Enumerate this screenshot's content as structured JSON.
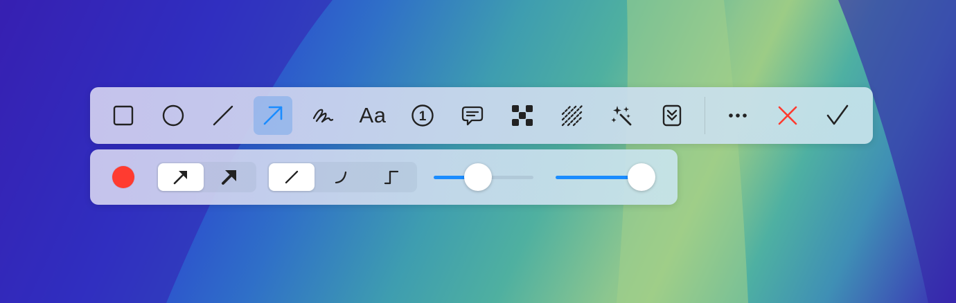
{
  "toolbar": {
    "tools": [
      {
        "name": "rectangle-tool",
        "icon": "rectangle-icon"
      },
      {
        "name": "ellipse-tool",
        "icon": "ellipse-icon"
      },
      {
        "name": "line-tool",
        "icon": "line-icon"
      },
      {
        "name": "arrow-tool",
        "icon": "arrow-icon",
        "active": true
      },
      {
        "name": "pen-tool",
        "icon": "scribble-icon"
      },
      {
        "name": "text-tool",
        "icon": "text-icon",
        "label": "Aa"
      },
      {
        "name": "counter-tool",
        "icon": "number-badge-icon",
        "label": "1"
      },
      {
        "name": "callout-tool",
        "icon": "speech-bubble-icon"
      },
      {
        "name": "pixelate-tool",
        "icon": "pixelate-icon"
      },
      {
        "name": "blur-tool",
        "icon": "hatch-icon"
      },
      {
        "name": "magic-tool",
        "icon": "magic-wand-icon"
      },
      {
        "name": "save-tool",
        "icon": "download-box-icon"
      }
    ],
    "more": "more-icon",
    "cancel": "close-icon",
    "confirm": "checkmark-icon",
    "accent": "#1a8cff",
    "cancel_color": "#ff3b30"
  },
  "options": {
    "color": "#ff3b30",
    "arrow_style": {
      "options": [
        "outline-arrow",
        "filled-arrow"
      ],
      "selected": "outline-arrow"
    },
    "line_style": {
      "options": [
        "straight",
        "curved",
        "elbow"
      ],
      "selected": "straight"
    },
    "size_slider": {
      "value": 0.43
    },
    "opacity_slider": {
      "value": 1.0
    }
  }
}
